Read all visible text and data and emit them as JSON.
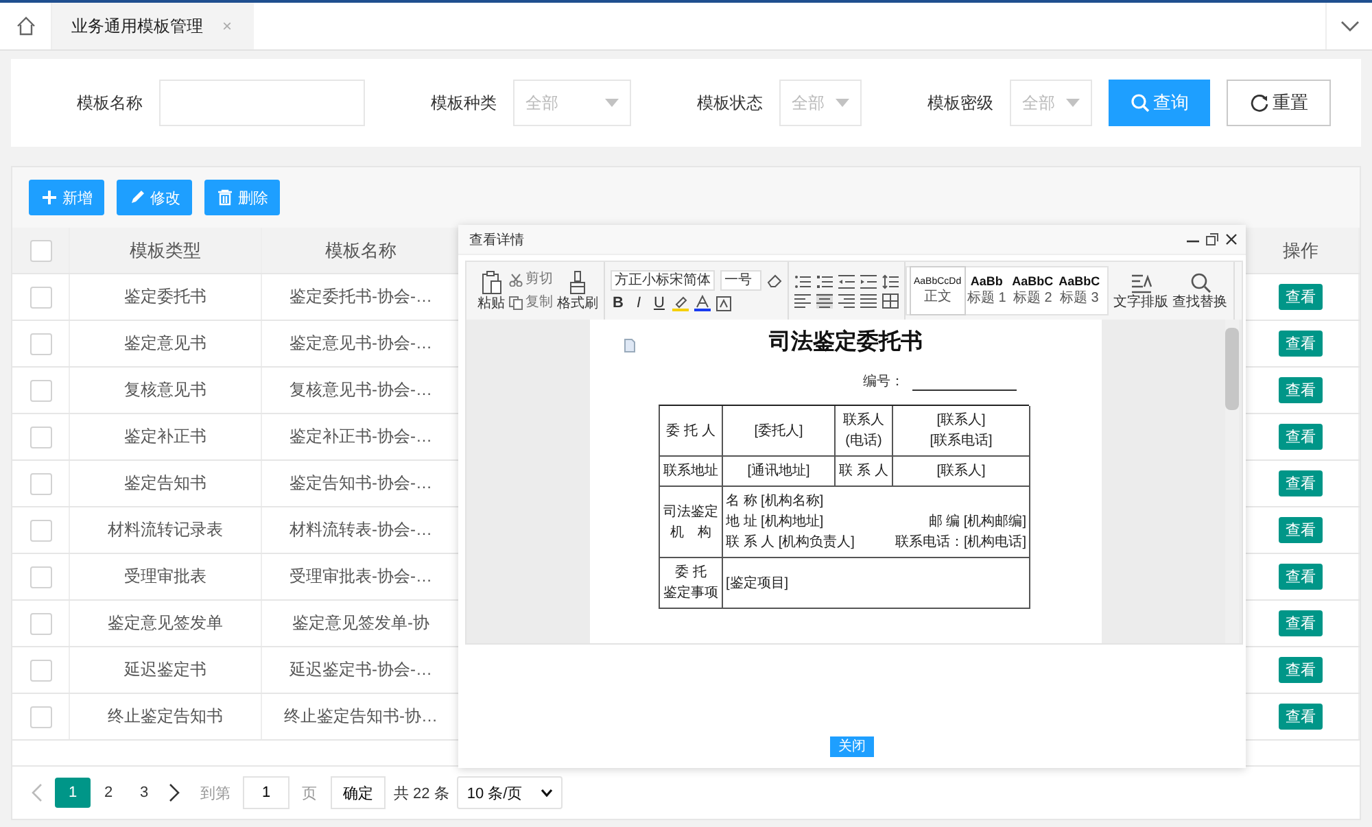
{
  "tabs": [
    {
      "label": "业务通用模板管理",
      "close": "×",
      "selected": true
    }
  ],
  "filters": [
    {
      "kind": "input",
      "label": "模板名称"
    },
    {
      "kind": "select",
      "label": "模板种类",
      "value": "全部"
    },
    {
      "kind": "select",
      "label": "模板状态",
      "value": "全部"
    },
    {
      "kind": "select",
      "label": "模板密级",
      "value": "全部"
    }
  ],
  "search_button": "查询",
  "reset_button": "重置",
  "actions": [
    {
      "label": "新增"
    },
    {
      "label": "修改"
    },
    {
      "label": "删除"
    }
  ],
  "table": {
    "all_checked": false,
    "columns": [
      "模板类型",
      "模板名称",
      "操作"
    ],
    "rows": [
      {
        "checked": false,
        "type": "鉴定委托书",
        "name": "鉴定委托书-协会-…",
        "action": "查看"
      },
      {
        "checked": false,
        "type": "鉴定意见书",
        "name": "鉴定意见书-协会-…",
        "action": "查看"
      },
      {
        "checked": false,
        "type": "复核意见书",
        "name": "复核意见书-协会-…",
        "action": "查看"
      },
      {
        "checked": false,
        "type": "鉴定补正书",
        "name": "鉴定补正书-协会-…",
        "action": "查看"
      },
      {
        "checked": false,
        "type": "鉴定告知书",
        "name": "鉴定告知书-协会-…",
        "action": "查看"
      },
      {
        "checked": false,
        "type": "材料流转记录表",
        "name": "材料流转表-协会-…",
        "action": "查看"
      },
      {
        "checked": false,
        "type": "受理审批表",
        "name": "受理审批表-协会-…",
        "action": "查看"
      },
      {
        "checked": false,
        "type": "鉴定意见签发单",
        "name": "鉴定意见签发单-协",
        "action": "查看"
      },
      {
        "checked": false,
        "type": "延迟鉴定书",
        "name": "延迟鉴定书-协会-…",
        "action": "查看"
      },
      {
        "checked": false,
        "type": "终止鉴定告知书",
        "name": "终止鉴定告知书-协…",
        "action": "查看"
      }
    ]
  },
  "dialog": {
    "title": "查看详情",
    "ribbon": {
      "clipboard": [
        {
          "label": "粘贴"
        },
        {
          "label": "剪切"
        },
        {
          "label": "复制"
        },
        {
          "label": "格式刷"
        }
      ],
      "font": {
        "name": "方正小标宋简体",
        "size": "一号"
      },
      "format_letters": [
        "B",
        "I",
        "U"
      ],
      "styles": [
        {
          "sample": "AaBbCcDd",
          "label": "正文",
          "selected": true
        },
        {
          "sample": "AaBb",
          "label": "标题 1",
          "selected": false
        },
        {
          "sample": "AaBbC",
          "label": "标题 2",
          "selected": false
        },
        {
          "sample": "AaBbC",
          "label": "标题 3",
          "selected": false
        }
      ],
      "tools": [
        {
          "label": "文字排版"
        },
        {
          "label": "查找替换"
        }
      ]
    },
    "document": {
      "title": "司法鉴定委托书",
      "number_label": "编号：",
      "rows": [
        {
          "cells": [
            {
              "lines": [
                {
                  "left": "委 托 人"
                }
              ]
            },
            {
              "lines": [
                {
                  "left": "[委托人]"
                }
              ]
            },
            {
              "lines": [
                {
                  "left": "联系人"
                },
                {
                  "left": "(电话)"
                }
              ]
            },
            {
              "lines": [
                {
                  "left": "[联系人]"
                },
                {
                  "left": "[联系电话]"
                }
              ]
            }
          ]
        },
        {
          "cells": [
            {
              "lines": [
                {
                  "left": "联系地址"
                }
              ]
            },
            {
              "lines": [
                {
                  "left": "[通讯地址]"
                }
              ]
            },
            {
              "lines": [
                {
                  "left": "联 系 人"
                }
              ]
            },
            {
              "lines": [
                {
                  "left": "[联系人]"
                }
              ]
            }
          ]
        },
        {
          "cells": [
            {
              "lines": [
                {
                  "left": "司法鉴定"
                },
                {
                  "left": "机　构"
                }
              ]
            },
            {
              "lines": [
                {
                  "left": "名 称 [机构名称]"
                },
                {
                  "left": "地 址 [机构地址]",
                  "right": "邮 编 [机构邮编]"
                },
                {
                  "left": "联 系 人 [机构负责人]",
                  "right": "联系电话：[机构电话]"
                }
              ]
            }
          ]
        },
        {
          "cells": [
            {
              "lines": [
                {
                  "left": "委 托"
                },
                {
                  "left": "鉴定事项"
                }
              ]
            },
            {
              "lines": [
                {
                  "left": "[鉴定项目]"
                }
              ]
            }
          ]
        }
      ]
    },
    "close_button": "关闭"
  },
  "pagination": {
    "pages": [
      {
        "label": "1",
        "selected": true
      },
      {
        "label": "2",
        "selected": false
      },
      {
        "label": "3",
        "selected": false
      }
    ],
    "goto_label": "到第",
    "goto_value": "1",
    "page_unit": "页",
    "confirm": "确定",
    "total": "共 22 条",
    "page_size": "10 条/页"
  }
}
